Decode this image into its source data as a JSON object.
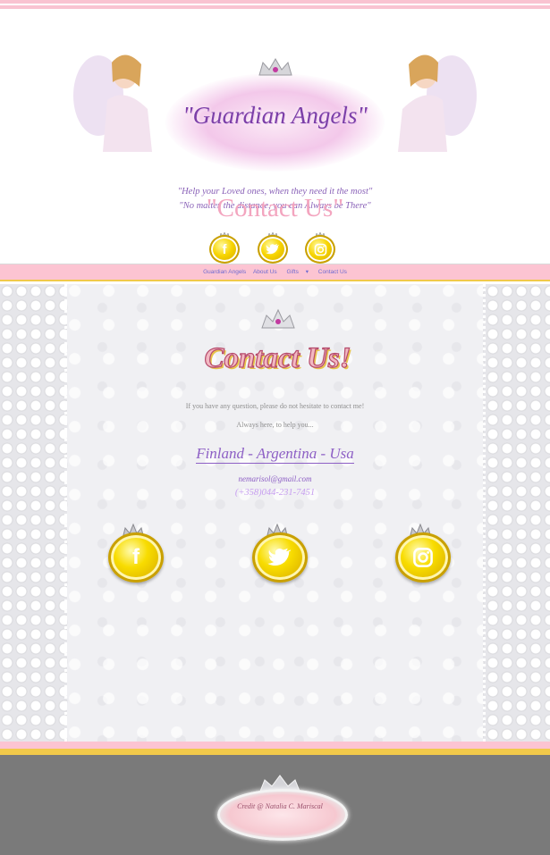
{
  "header": {
    "brand_title": "\"Guardian Angels\"",
    "tagline_line1": "\"Help your Loved ones, when they need it the most\"",
    "tagline_line2": "\"No matter the distance, you can Always be There\"",
    "page_heading": "\"Contact Us\"",
    "social_icons": [
      {
        "icon": "facebook-icon",
        "glyph": "f"
      },
      {
        "icon": "twitter-icon",
        "glyph": "🐦"
      },
      {
        "icon": "instagram-icon",
        "glyph": "◎"
      }
    ]
  },
  "nav": {
    "items": [
      "Guardian Angels",
      "About Us",
      "Gifts",
      "Contact Us"
    ],
    "gifts_caret": "▾"
  },
  "content": {
    "title": "Contact Us!",
    "intro_line1": "If you have any question, please do not hesitate to contact me!",
    "intro_line2": "Always here, to help you...",
    "locations": "Finland - Argentina - Usa",
    "email": "nemarisol@gmail.com",
    "phone": "(+358)044-231-7451"
  },
  "footer": {
    "credit": "Credit @ Natalia C. Mariscal"
  },
  "colors": {
    "pink_stripe": "#fcc4d2",
    "gold_stripe": "#f1c94a",
    "heading_pink": "#f3a5bf",
    "accent_purple": "#8d5fc5",
    "footer_gray": "#7a7a7a"
  }
}
